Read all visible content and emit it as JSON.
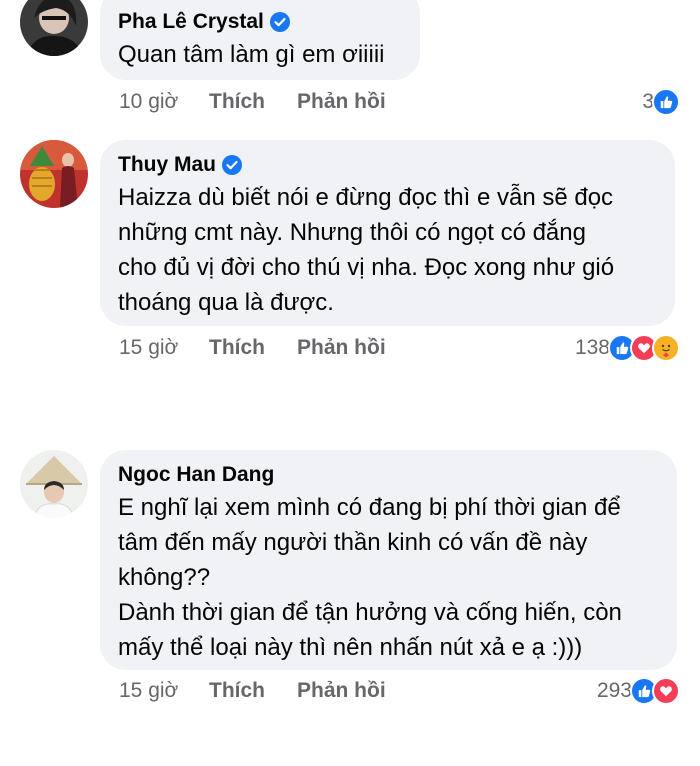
{
  "comments": [
    {
      "author": "Pha Lê Crystal",
      "lines": [
        "Quan tâm làm gì em ơiiiii"
      ],
      "time": "10 giờ",
      "like_label": "Thích",
      "reply_label": "Phản hồi",
      "reaction_count": "3",
      "reactions": [
        "like-icon"
      ]
    },
    {
      "author": "Thuy Mau",
      "lines": [
        "Haizza dù biết nói e đừng đọc thì e vẫn sẽ đọc",
        "những cmt này. Nhưng thôi có ngọt có đắng",
        "cho đủ vị đời cho thú vị nha. Đọc xong như gió",
        "thoáng qua là được."
      ],
      "time": "15 giờ",
      "like_label": "Thích",
      "reply_label": "Phản hồi",
      "reaction_count": "138",
      "reactions": [
        "like-icon",
        "love-icon",
        "care-icon"
      ]
    },
    {
      "author": "Ngoc Han Dang",
      "lines": [
        "E nghĩ lại xem mình có đang bị phí thời gian để",
        "tâm đến mấy người thần kinh có vấn đề này",
        "không??",
        "Dành thời gian để tận hưởng và cống hiến, còn",
        "mấy thể loại này thì nên nhấn nút xả e ạ :)))"
      ],
      "time": "15 giờ",
      "like_label": "Thích",
      "reply_label": "Phản hồi",
      "reaction_count": "293",
      "reactions": [
        "like-icon",
        "love-icon"
      ]
    }
  ],
  "colors": {
    "bubble": "#f0f2f5",
    "meta": "#65676b",
    "verified": "#1877f2",
    "like": "#1877f2",
    "love": "#f33e58",
    "care": "#f7b125"
  }
}
